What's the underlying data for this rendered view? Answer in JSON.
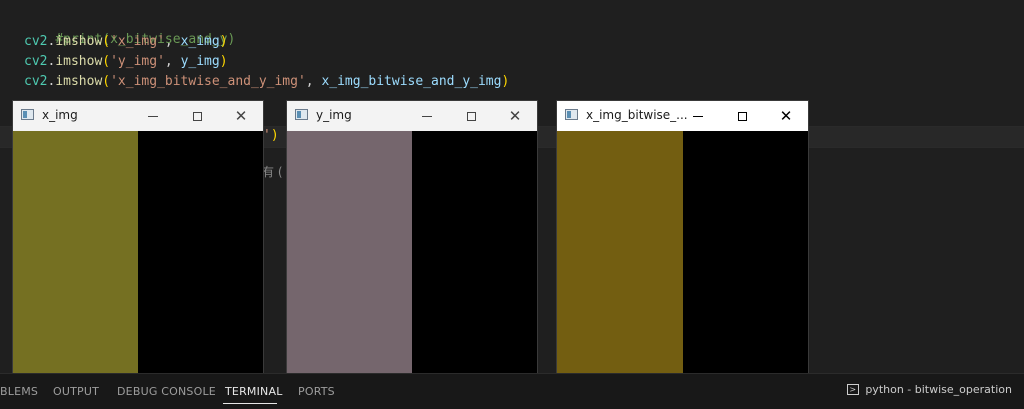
{
  "editor": {
    "lines": [
      {
        "type": "comment",
        "text": "#print(x_bitwise_and_y)"
      },
      {
        "type": "call",
        "obj": "cv2",
        "method": "imshow",
        "arg1": "'x_img'",
        "arg2": "x_img"
      },
      {
        "type": "call",
        "obj": "cv2",
        "method": "imshow",
        "arg1": "'y_img'",
        "arg2": "y_img"
      },
      {
        "type": "call",
        "obj": "cv2",
        "method": "imshow",
        "arg1": "'x_img_bitwise_and_y_img'",
        "arg2": "x_img_bitwise_and_y_img"
      }
    ],
    "partial_code": "')",
    "partial_text": "有 ("
  },
  "windows": [
    {
      "title": "x_img",
      "band_color": "#757022",
      "active": false
    },
    {
      "title": "y_img",
      "band_color": "#75666d",
      "active": false
    },
    {
      "title": "x_img_bitwise_...",
      "band_color": "#735e11",
      "active": true
    }
  ],
  "panel": {
    "tabs": [
      "BLEMS",
      "OUTPUT",
      "DEBUG CONSOLE",
      "TERMINAL",
      "PORTS"
    ],
    "active_tab": "TERMINAL",
    "terminal_label": "python - bitwise_operation"
  }
}
